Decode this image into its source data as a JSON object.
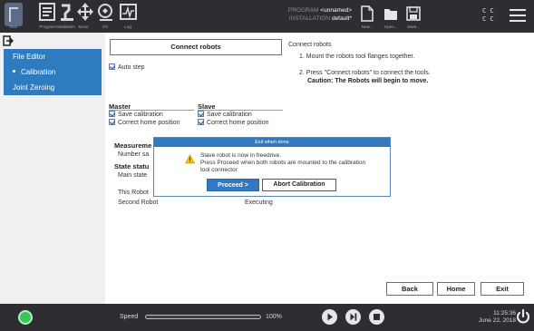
{
  "topbar": {
    "nav": [
      {
        "label": "Run",
        "icon": "run-icon"
      },
      {
        "label": "Program",
        "icon": "program-icon"
      },
      {
        "label": "Installation",
        "icon": "installation-icon"
      },
      {
        "label": "Move",
        "icon": "move-icon"
      },
      {
        "label": "I/O",
        "icon": "io-icon"
      },
      {
        "label": "Log",
        "icon": "log-icon"
      }
    ],
    "program_label": "PROGRAM",
    "program_value": "<unnamed>",
    "installation_label": "INSTALLATION",
    "installation_value": "default*",
    "file_actions": [
      {
        "label": "New...",
        "icon": "new-file-icon"
      },
      {
        "label": "Open...",
        "icon": "open-folder-icon"
      },
      {
        "label": "Save...",
        "icon": "save-icon"
      }
    ],
    "cc_top": "C C",
    "cc_bottom": "C C"
  },
  "left_nav": {
    "items": [
      {
        "label": "File Editor"
      },
      {
        "label": "Calibration",
        "active": true
      },
      {
        "label": "Joint Zeroing"
      }
    ]
  },
  "main": {
    "connect_button": "Connect robots",
    "auto_step_label": "Auto step",
    "instructions": {
      "title": "Connect robots",
      "step1": "1. Mount the robots tool flanges together.",
      "step2": "2. Press \"Connect robots\" to connect the tools.",
      "caution": "Caution: The Robots will begin to move."
    },
    "master": {
      "header": "Master",
      "save_calibration": "Save calibration",
      "correct_home": "Correct home position"
    },
    "slave": {
      "header": "Slave",
      "save_calibration": "Save calibration",
      "correct_home": "Correct home position"
    },
    "measurements_header": "Measureme",
    "number_samples": "Number sa",
    "state_header": "State statu",
    "main_state": "Main state",
    "this_robot": "This Robot",
    "second_robot": "Second Robot",
    "second_robot_state": "Executing",
    "back_button": "Back",
    "home_button": "Home",
    "exit_button": "Exit"
  },
  "modal": {
    "title": "Exit when done",
    "line1": "Slave robot is now in freedrive.",
    "line2": "Press Proceed when both robots are mounted to the calibration",
    "line3": "tool connector",
    "proceed": "Proceed >",
    "abort": "Abort Calibration"
  },
  "bottombar": {
    "speed_label": "Speed",
    "speed_value": "100%",
    "speed_fraction": 1.0,
    "time": "11:25:36",
    "date": "June 22, 2018",
    "status_color": "#38c75a"
  }
}
